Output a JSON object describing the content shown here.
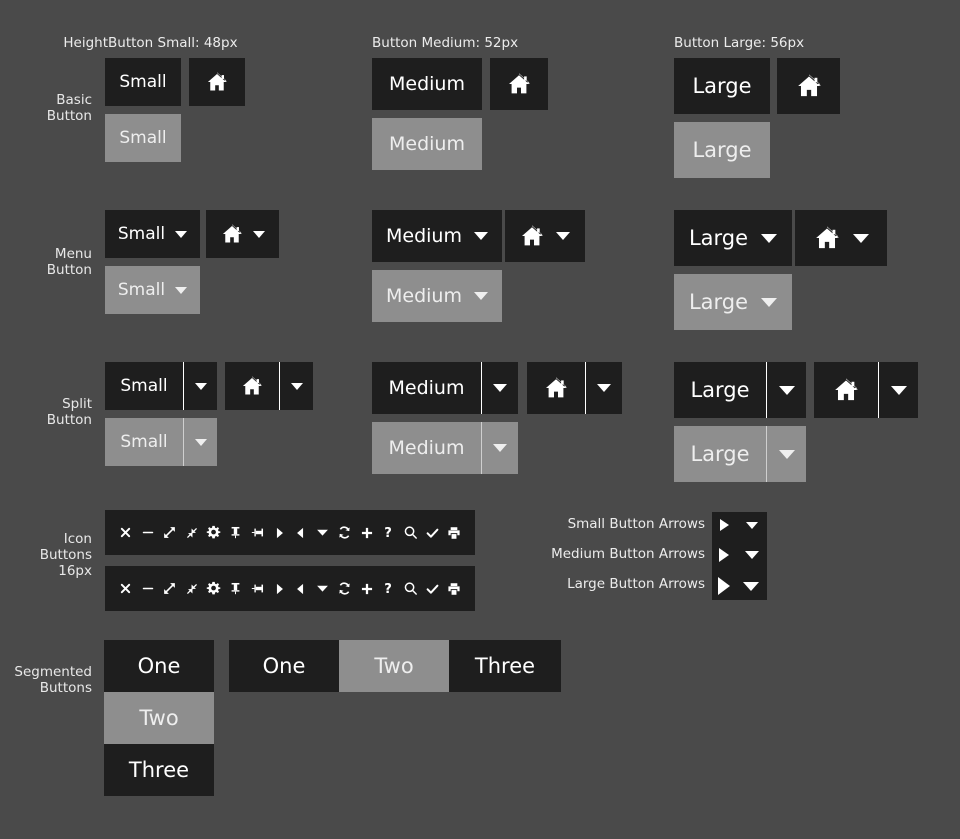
{
  "meta": {
    "background_color": "#4a4a4a",
    "button_color": "#1e1e1e",
    "disabled_color": "#8e8e8e",
    "text_color": "#ffffff"
  },
  "headers": {
    "height_label": "Height",
    "columns": [
      "Button Small: 48px",
      "Button Medium: 52px",
      "Button Large: 56px"
    ]
  },
  "row_labels": {
    "basic": "Basic\nButton",
    "menu": "Menu\nButton",
    "split": "Split\nButton",
    "icon": "Icon\nButtons\n16px",
    "segmented": "Segmented\nButtons"
  },
  "basic_button": {
    "small": {
      "label": "Small",
      "disabled_label": "Small",
      "icon": "home-icon"
    },
    "medium": {
      "label": "Medium",
      "disabled_label": "Medium",
      "icon": "home-icon"
    },
    "large": {
      "label": "Large",
      "disabled_label": "Large",
      "icon": "home-icon"
    }
  },
  "menu_button": {
    "small": {
      "label": "Small",
      "disabled_label": "Small",
      "icon": "home-icon",
      "arrow": "chevron-down-icon"
    },
    "medium": {
      "label": "Medium",
      "disabled_label": "Medium",
      "icon": "home-icon",
      "arrow": "chevron-down-icon"
    },
    "large": {
      "label": "Large",
      "disabled_label": "Large",
      "icon": "home-icon",
      "arrow": "chevron-down-icon"
    }
  },
  "split_button": {
    "small": {
      "label": "Small",
      "disabled_label": "Small",
      "icon": "home-icon",
      "arrow": "chevron-down-icon"
    },
    "medium": {
      "label": "Medium",
      "disabled_label": "Medium",
      "icon": "home-icon",
      "arrow": "chevron-down-icon"
    },
    "large": {
      "label": "Large",
      "disabled_label": "Large",
      "icon": "home-icon",
      "arrow": "chevron-down-icon"
    }
  },
  "icon_toolbar": {
    "size": "16px",
    "icons": [
      "close-icon",
      "minimize-icon",
      "expand-diagonal-icon",
      "collapse-diagonal-icon",
      "gear-icon",
      "pin-vertical-icon",
      "pin-horizontal-icon",
      "triangle-right-icon",
      "triangle-left-icon",
      "triangle-down-icon",
      "refresh-icon",
      "plus-icon",
      "question-icon",
      "search-icon",
      "check-icon",
      "print-icon"
    ]
  },
  "arrow_samples": {
    "rows": [
      {
        "label": "Small Button Arrows",
        "right_arrow": "triangle-right-icon",
        "down_arrow": "triangle-down-icon"
      },
      {
        "label": "Medium Button Arrows",
        "right_arrow": "triangle-right-icon",
        "down_arrow": "triangle-down-icon"
      },
      {
        "label": "Large Button Arrows",
        "right_arrow": "triangle-right-icon",
        "down_arrow": "triangle-down-icon"
      }
    ]
  },
  "segmented_buttons": {
    "vertical": {
      "items": [
        "One",
        "Two",
        "Three"
      ],
      "selected_index": 1
    },
    "horizontal": {
      "items": [
        "One",
        "Two",
        "Three"
      ],
      "selected_index": 1
    }
  }
}
